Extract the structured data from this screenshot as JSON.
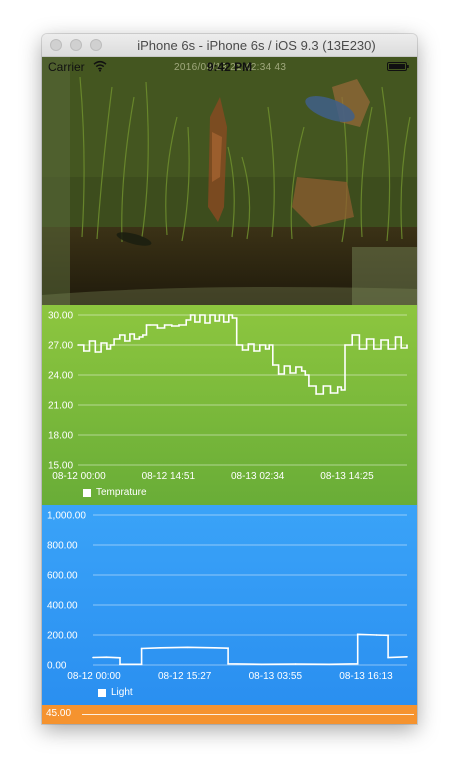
{
  "window": {
    "title": "iPhone 6s - iPhone 6s / iOS 9.3 (13E230)"
  },
  "status_bar": {
    "carrier": "Carrier",
    "time": "9:42 PM",
    "overlay_timestamp": "2016/08/13 21:42:34 43"
  },
  "icons": {
    "wifi": "wifi-icon",
    "battery": "battery-icon",
    "camera": "camera-feed-image"
  },
  "colors": {
    "temp_panel": "#7dbb3b",
    "light_panel": "#2f97f4",
    "extra_panel": "#f5932f",
    "line": "#ffffff"
  },
  "chart_data": [
    {
      "type": "line",
      "title": "",
      "xlabel": "",
      "ylabel": "",
      "legend": "bottom-left",
      "grid": true,
      "ylim": [
        15,
        30
      ],
      "y_ticks": [
        "30.00",
        "27.00",
        "24.00",
        "21.00",
        "18.00",
        "15.00"
      ],
      "x_ticks": [
        "08-12 00:00",
        "08-12 14:51",
        "08-13 02:34",
        "08-13 14:25"
      ],
      "x_range_hours": [
        0,
        45.6
      ],
      "series": [
        {
          "name": "Temprature",
          "x": [
            0,
            0.8,
            1.6,
            2.4,
            3.2,
            4.0,
            4.5,
            5.0,
            5.8,
            6.5,
            7.2,
            7.8,
            8.5,
            9.0,
            9.5,
            10.0,
            11.0,
            12.0,
            13.0,
            14.0,
            15.0,
            15.6,
            16.2,
            16.9,
            17.6,
            18.3,
            19.0,
            19.6,
            20.2,
            20.9,
            21.4,
            22.0,
            22.8,
            23.6,
            24.4,
            25.2,
            26.0,
            26.5,
            27.0,
            27.8,
            28.6,
            29.4,
            30.2,
            31.0,
            31.5,
            32.0,
            33.0,
            34.0,
            35.0,
            36.0,
            36.5,
            37.0,
            38.0,
            39.0,
            40.0,
            41.0,
            42.0,
            43.0,
            44.0,
            44.8,
            45.6
          ],
          "values": [
            27.0,
            26.4,
            27.4,
            26.3,
            27.2,
            26.6,
            27.0,
            27.6,
            28.0,
            27.4,
            28.1,
            27.6,
            27.8,
            28.0,
            29.0,
            29.0,
            28.7,
            29.0,
            28.9,
            29.0,
            29.5,
            30.0,
            29.3,
            30.0,
            29.2,
            30.0,
            29.4,
            30.0,
            29.3,
            30.0,
            29.7,
            27.0,
            26.5,
            27.1,
            26.4,
            27.0,
            26.6,
            27.0,
            25.0,
            24.1,
            24.9,
            24.2,
            24.8,
            24.4,
            24.0,
            22.9,
            22.1,
            22.9,
            22.2,
            22.8,
            22.5,
            27.0,
            28.0,
            26.6,
            27.6,
            26.6,
            27.5,
            26.6,
            27.8,
            26.7,
            27.0
          ]
        }
      ]
    },
    {
      "type": "line",
      "title": "",
      "xlabel": "",
      "ylabel": "",
      "legend": "bottom-left",
      "grid": true,
      "ylim": [
        0,
        1000
      ],
      "y_ticks": [
        "1,000.00",
        "800.00",
        "600.00",
        "400.00",
        "200.00",
        "0.00"
      ],
      "x_ticks": [
        "08-12 00:00",
        "08-12 15:27",
        "08-13 03:55",
        "08-13 16:13"
      ],
      "x_range_hours": [
        0,
        46.5
      ],
      "series": [
        {
          "name": "Light",
          "x": [
            0,
            2.0,
            4.0,
            4.0,
            7.2,
            7.2,
            10.0,
            14.0,
            18.0,
            20.0,
            20.0,
            25.0,
            30.0,
            35.0,
            39.2,
            39.2,
            42.0,
            43.7,
            43.7,
            46.5
          ],
          "values": [
            50,
            52,
            48,
            5,
            5,
            110,
            115,
            118,
            115,
            112,
            8,
            5,
            6,
            5,
            8,
            205,
            200,
            198,
            50,
            55
          ]
        }
      ]
    },
    {
      "type": "line",
      "title": "",
      "xlabel": "",
      "ylabel": "",
      "y_ticks": [
        "45.00"
      ],
      "series": []
    }
  ]
}
